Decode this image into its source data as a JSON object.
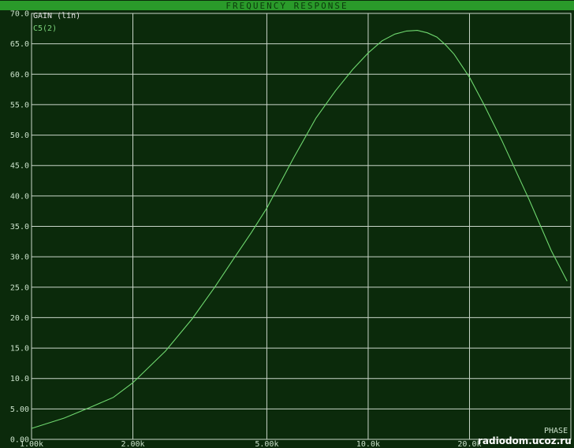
{
  "window": {
    "title": "FREQUENCY RESPONSE"
  },
  "legend": {
    "header": "GAIN (lin)",
    "series_label": "C5(2)"
  },
  "corner_label": "PHASE",
  "watermark": "radiodom.ucoz.ru",
  "colors": {
    "background": "#0b2a0b",
    "titlebar": "#2a9a2a",
    "grid": "#c9d6c9",
    "trace": "#6fd86f",
    "tick_text": "#c9e0c9",
    "legend_header": "#e0e0e0",
    "legend_series": "#7ad27a"
  },
  "chart_data": {
    "type": "line",
    "title": "FREQUENCY RESPONSE",
    "xscale": "log",
    "xlim": [
      1000,
      40000
    ],
    "ylim": [
      0,
      70
    ],
    "grid": true,
    "legend_position": "top-left",
    "x_ticks": [
      {
        "value": 1000,
        "label": "1.00k"
      },
      {
        "value": 2000,
        "label": "2.00k"
      },
      {
        "value": 5000,
        "label": "5.00k"
      },
      {
        "value": 10000,
        "label": "10.0k"
      },
      {
        "value": 20000,
        "label": "20.0k"
      }
    ],
    "y_ticks": [
      {
        "value": 0,
        "label": "0.00"
      },
      {
        "value": 5,
        "label": "5.00"
      },
      {
        "value": 10,
        "label": "10.0"
      },
      {
        "value": 15,
        "label": "15.0"
      },
      {
        "value": 20,
        "label": "20.0"
      },
      {
        "value": 25,
        "label": "25.0"
      },
      {
        "value": 30,
        "label": "30.0"
      },
      {
        "value": 35,
        "label": "35.0"
      },
      {
        "value": 40,
        "label": "40.0"
      },
      {
        "value": 45,
        "label": "45.0"
      },
      {
        "value": 50,
        "label": "50.0"
      },
      {
        "value": 55,
        "label": "55.0"
      },
      {
        "value": 60,
        "label": "60.0"
      },
      {
        "value": 65,
        "label": "65.0"
      },
      {
        "value": 70,
        "label": "70.0"
      }
    ],
    "series": [
      {
        "name": "C5(2)",
        "x": [
          1000,
          1250,
          1500,
          1750,
          2000,
          2500,
          3000,
          3500,
          4000,
          4500,
          5000,
          5500,
          6000,
          7000,
          8000,
          9000,
          10000,
          11000,
          12000,
          13000,
          14000,
          15000,
          16000,
          17000,
          18000,
          20000,
          22000,
          25000,
          30000,
          35000,
          39000
        ],
        "y": [
          1.8,
          3.5,
          5.3,
          6.9,
          9.3,
          14.5,
          19.8,
          25.0,
          29.8,
          34.0,
          38.0,
          42.3,
          46.2,
          52.8,
          57.3,
          60.8,
          63.5,
          65.5,
          66.6,
          67.1,
          67.2,
          66.8,
          66.1,
          64.8,
          63.3,
          59.5,
          55.2,
          49.0,
          39.5,
          31.0,
          26.0
        ]
      }
    ]
  }
}
